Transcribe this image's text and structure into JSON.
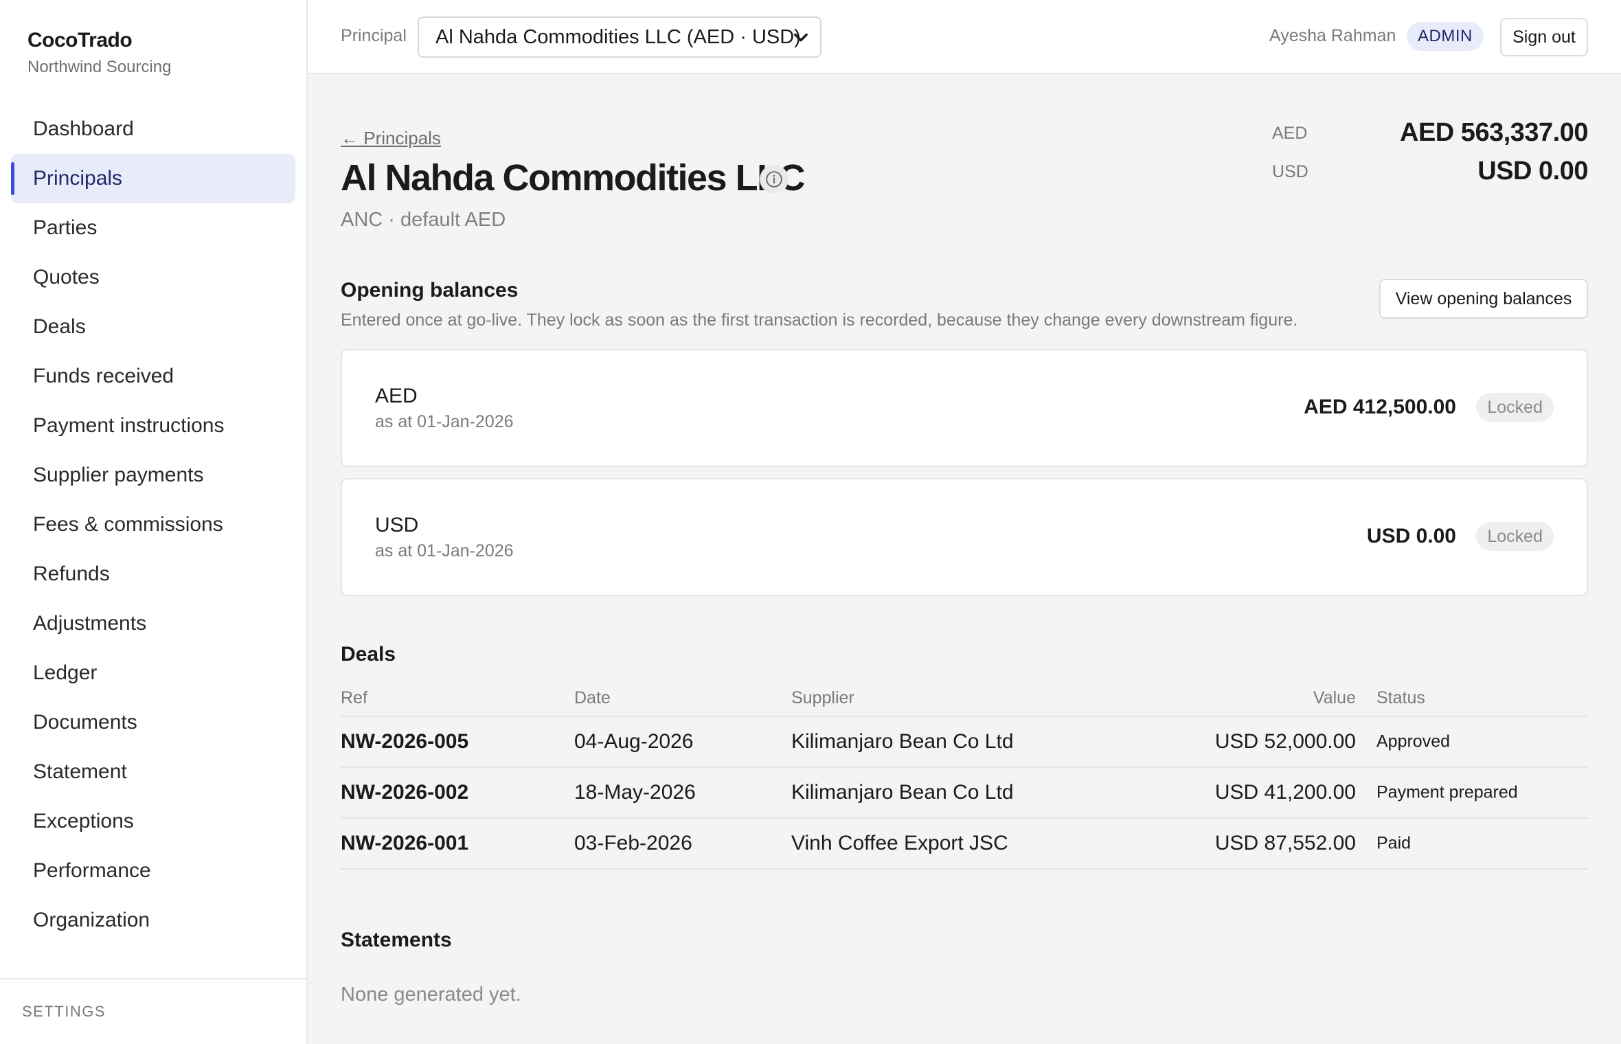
{
  "brand": {
    "name": "CocoTrado",
    "org": "Northwind Sourcing"
  },
  "nav": {
    "items": [
      {
        "label": "Dashboard"
      },
      {
        "label": "Principals",
        "active": true
      },
      {
        "label": "Parties"
      },
      {
        "label": "Quotes"
      },
      {
        "label": "Deals"
      },
      {
        "label": "Funds received"
      },
      {
        "label": "Payment instructions"
      },
      {
        "label": "Supplier payments"
      },
      {
        "label": "Fees & commissions"
      },
      {
        "label": "Refunds"
      },
      {
        "label": "Adjustments"
      },
      {
        "label": "Ledger"
      },
      {
        "label": "Documents"
      },
      {
        "label": "Statement"
      },
      {
        "label": "Exceptions"
      },
      {
        "label": "Performance"
      },
      {
        "label": "Organization"
      }
    ],
    "footer": "SETTINGS"
  },
  "topbar": {
    "principal_label": "Principal",
    "principal_selected": "Al Nahda Commodities LLC (AED · USD)",
    "user_name": "Ayesha Rahman",
    "role": "ADMIN",
    "signout": "Sign out"
  },
  "page": {
    "back": "← Principals",
    "title": "Al Nahda Commodities LLC",
    "subtitle": "ANC · default AED",
    "totals": [
      {
        "currency": "AED",
        "amount": "AED 563,337.00"
      },
      {
        "currency": "USD",
        "amount": "USD 0.00"
      }
    ]
  },
  "opening_balances": {
    "title": "Opening balances",
    "description": "Entered once at go-live. They lock as soon as the first transaction is recorded, because they change every downstream figure.",
    "view_button": "View opening balances",
    "rows": [
      {
        "currency": "AED",
        "as_at": "as at 01-Jan-2026",
        "amount": "AED 412,500.00",
        "status": "Locked"
      },
      {
        "currency": "USD",
        "as_at": "as at 01-Jan-2026",
        "amount": "USD 0.00",
        "status": "Locked"
      }
    ]
  },
  "deals": {
    "title": "Deals",
    "columns": {
      "ref": "Ref",
      "date": "Date",
      "supplier": "Supplier",
      "value": "Value",
      "status": "Status"
    },
    "rows": [
      {
        "ref": "NW-2026-005",
        "date": "04-Aug-2026",
        "supplier": "Kilimanjaro Bean Co Ltd",
        "value": "USD 52,000.00",
        "status": "Approved"
      },
      {
        "ref": "NW-2026-002",
        "date": "18-May-2026",
        "supplier": "Kilimanjaro Bean Co Ltd",
        "value": "USD 41,200.00",
        "status": "Payment prepared"
      },
      {
        "ref": "NW-2026-001",
        "date": "03-Feb-2026",
        "supplier": "Vinh Coffee Export JSC",
        "value": "USD 87,552.00",
        "status": "Paid"
      }
    ]
  },
  "statements": {
    "title": "Statements",
    "empty": "None generated yet."
  }
}
